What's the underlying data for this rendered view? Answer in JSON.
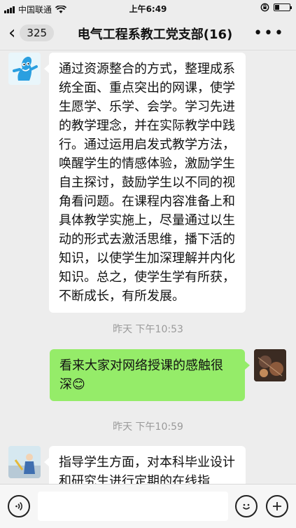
{
  "status_bar": {
    "carrier": "中国联通",
    "time": "上午6:49",
    "battery_level": 0.3
  },
  "nav": {
    "unread_count": "325",
    "title": "电气工程系教工党支部(16)"
  },
  "messages": [
    {
      "side": "left",
      "text": "通过资源整合的方式，整理成系统全面、重点突出的网课，使学生愿学、乐学、会学。学习先进的教学理念，并在实际教学中践行。通过运用启发式教学方法，唤醒学生的情感体验，激励学生自主探讨，鼓励学生以不同的视角看问题。在课程内容准备上和具体教学实施上，尽量通过以生动的形式去激活思维，播下活的知识，以使学生加深理解并内化知识。总之，使学生学有所获，不断成长，有所发展。"
    },
    {
      "timestamp": "昨天 下午10:53"
    },
    {
      "side": "right",
      "text": "看来大家对网络授课的感触很深",
      "emoji": "😊"
    },
    {
      "timestamp": "昨天 下午10:59"
    },
    {
      "side": "left",
      "text": "指导学生方面，对本科毕业设计和研究生进行定期的在线指"
    }
  ],
  "colors": {
    "background": "#ededed",
    "bubble_self": "#95ec69",
    "bubble_other": "#ffffff",
    "timestamp": "#9a9a9a"
  },
  "icons": {
    "voice": "voice-icon",
    "emoji": "emoji-icon",
    "plus": "plus-icon",
    "back": "chevron-left-icon",
    "more": "more-icon"
  }
}
